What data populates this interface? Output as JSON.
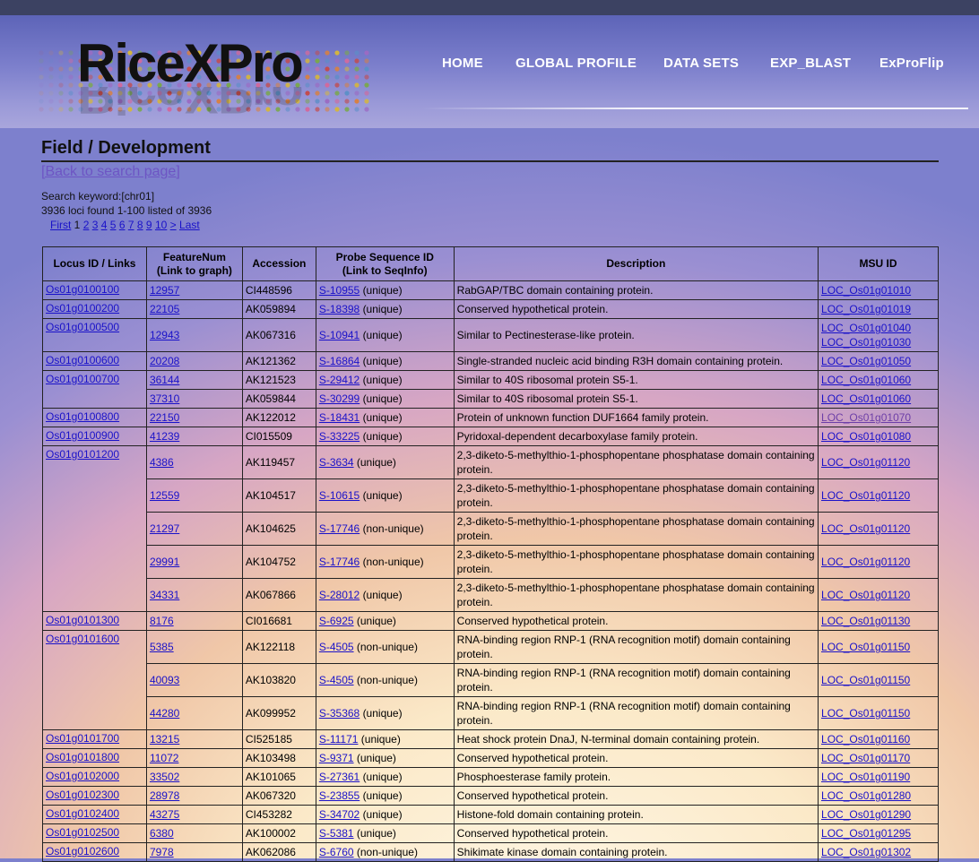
{
  "logo": {
    "text": "RiceXPro"
  },
  "nav": {
    "home": "HOME",
    "global": "GLOBAL PROFILE",
    "datasets": "DATA SETS",
    "expblast": "EXP_BLAST",
    "exproflip": "ExProFlip"
  },
  "page": {
    "title": "Field / Development",
    "back": "[Back to search page]",
    "keyword": "Search keyword:[chr01]",
    "found": "3936 loci found 1-100 listed of 3936",
    "pager": {
      "first": "First",
      "current": "1",
      "pages": [
        "2",
        "3",
        "4",
        "5",
        "6",
        "7",
        "8",
        "9",
        "10"
      ],
      "next": ">",
      "last": "Last"
    }
  },
  "table": {
    "headers": {
      "locus": "Locus ID / Links",
      "feature1": "FeatureNum",
      "feature2": "(Link to graph)",
      "accession": "Accession",
      "probe1": "Probe Sequence ID",
      "probe2": "(Link to SeqInfo)",
      "description": "Description",
      "msu": "MSU ID"
    },
    "groups": [
      {
        "locus": "Os01g0100100",
        "rows": [
          {
            "feature": "12957",
            "accession": "CI448596",
            "probe": "S-10955",
            "uniq": "(unique)",
            "desc": "RabGAP/TBC domain containing protein.",
            "msu": [
              "LOC_Os01g01010"
            ]
          }
        ]
      },
      {
        "locus": "Os01g0100200",
        "rows": [
          {
            "feature": "22105",
            "accession": "AK059894",
            "probe": "S-18398",
            "uniq": "(unique)",
            "desc": "Conserved hypothetical protein.",
            "msu": [
              "LOC_Os01g01019"
            ]
          }
        ]
      },
      {
        "locus": "Os01g0100500",
        "rows": [
          {
            "feature": "12943",
            "accession": "AK067316",
            "probe": "S-10941",
            "uniq": "(unique)",
            "desc": "Similar to Pectinesterase-like protein.",
            "msu": [
              "LOC_Os01g01040",
              "LOC_Os01g01030"
            ]
          }
        ]
      },
      {
        "locus": "Os01g0100600",
        "rows": [
          {
            "feature": "20208",
            "accession": "AK121362",
            "probe": "S-16864",
            "uniq": "(unique)",
            "desc": "Single-stranded nucleic acid binding R3H domain containing protein.",
            "msu": [
              "LOC_Os01g01050"
            ]
          }
        ]
      },
      {
        "locus": "Os01g0100700",
        "rows": [
          {
            "feature": "36144",
            "accession": "AK121523",
            "probe": "S-29412",
            "uniq": "(unique)",
            "desc": "Similar to 40S ribosomal protein S5-1.",
            "msu": [
              "LOC_Os01g01060"
            ]
          },
          {
            "feature": "37310",
            "accession": "AK059844",
            "probe": "S-30299",
            "uniq": "(unique)",
            "desc": "Similar to 40S ribosomal protein S5-1.",
            "msu": [
              "LOC_Os01g01060"
            ]
          }
        ]
      },
      {
        "locus": "Os01g0100800",
        "rows": [
          {
            "feature": "22150",
            "accession": "AK122012",
            "probe": "S-18431",
            "uniq": "(unique)",
            "desc": "Protein of unknown function DUF1664 family protein.",
            "msu": [
              "LOC_Os01g01070"
            ]
          }
        ]
      },
      {
        "locus": "Os01g0100900",
        "rows": [
          {
            "feature": "41239",
            "accession": "CI015509",
            "probe": "S-33225",
            "uniq": "(unique)",
            "desc": "Pyridoxal-dependent decarboxylase family protein.",
            "msu": [
              "LOC_Os01g01080"
            ]
          }
        ]
      },
      {
        "locus": "Os01g0101200",
        "rows": [
          {
            "feature": "4386",
            "accession": "AK119457",
            "probe": "S-3634",
            "uniq": "(unique)",
            "desc": "2,3-diketo-5-methylthio-1-phosphopentane phosphatase domain containing protein.",
            "msu": [
              "LOC_Os01g01120"
            ]
          },
          {
            "feature": "12559",
            "accession": "AK104517",
            "probe": "S-10615",
            "uniq": "(unique)",
            "desc": "2,3-diketo-5-methylthio-1-phosphopentane phosphatase domain containing protein.",
            "msu": [
              "LOC_Os01g01120"
            ]
          },
          {
            "feature": "21297",
            "accession": "AK104625",
            "probe": "S-17746",
            "uniq": "(non-unique)",
            "desc": "2,3-diketo-5-methylthio-1-phosphopentane phosphatase domain containing protein.",
            "msu": [
              "LOC_Os01g01120"
            ]
          },
          {
            "feature": "29991",
            "accession": "AK104752",
            "probe": "S-17746",
            "uniq": "(non-unique)",
            "desc": "2,3-diketo-5-methylthio-1-phosphopentane phosphatase domain containing protein.",
            "msu": [
              "LOC_Os01g01120"
            ]
          },
          {
            "feature": "34331",
            "accession": "AK067866",
            "probe": "S-28012",
            "uniq": "(unique)",
            "desc": "2,3-diketo-5-methylthio-1-phosphopentane phosphatase domain containing protein.",
            "msu": [
              "LOC_Os01g01120"
            ]
          }
        ]
      },
      {
        "locus": "Os01g0101300",
        "rows": [
          {
            "feature": "8176",
            "accession": "CI016681",
            "probe": "S-6925",
            "uniq": "(unique)",
            "desc": "Conserved hypothetical protein.",
            "msu": [
              "LOC_Os01g01130"
            ]
          }
        ]
      },
      {
        "locus": "Os01g0101600",
        "rows": [
          {
            "feature": "5385",
            "accession": "AK122118",
            "probe": "S-4505",
            "uniq": "(non-unique)",
            "desc": "RNA-binding region RNP-1 (RNA recognition motif) domain containing protein.",
            "msu": [
              "LOC_Os01g01150"
            ]
          },
          {
            "feature": "40093",
            "accession": "AK103820",
            "probe": "S-4505",
            "uniq": "(non-unique)",
            "desc": "RNA-binding region RNP-1 (RNA recognition motif) domain containing protein.",
            "msu": [
              "LOC_Os01g01150"
            ]
          },
          {
            "feature": "44280",
            "accession": "AK099952",
            "probe": "S-35368",
            "uniq": "(unique)",
            "desc": "RNA-binding region RNP-1 (RNA recognition motif) domain containing protein.",
            "msu": [
              "LOC_Os01g01150"
            ]
          }
        ]
      },
      {
        "locus": "Os01g0101700",
        "rows": [
          {
            "feature": "13215",
            "accession": "CI525185",
            "probe": "S-11171",
            "uniq": "(unique)",
            "desc": "Heat shock protein DnaJ, N-terminal domain containing protein.",
            "msu": [
              "LOC_Os01g01160"
            ]
          }
        ]
      },
      {
        "locus": "Os01g0101800",
        "rows": [
          {
            "feature": "11072",
            "accession": "AK103498",
            "probe": "S-9371",
            "uniq": "(unique)",
            "desc": "Conserved hypothetical protein.",
            "msu": [
              "LOC_Os01g01170"
            ]
          }
        ]
      },
      {
        "locus": "Os01g0102000",
        "rows": [
          {
            "feature": "33502",
            "accession": "AK101065",
            "probe": "S-27361",
            "uniq": "(unique)",
            "desc": "Phosphoesterase family protein.",
            "msu": [
              "LOC_Os01g01190"
            ]
          }
        ]
      },
      {
        "locus": "Os01g0102300",
        "rows": [
          {
            "feature": "28978",
            "accession": "AK067320",
            "probe": "S-23855",
            "uniq": "(unique)",
            "desc": "Conserved hypothetical protein.",
            "msu": [
              "LOC_Os01g01280"
            ]
          }
        ]
      },
      {
        "locus": "Os01g0102400",
        "rows": [
          {
            "feature": "43275",
            "accession": "CI453282",
            "probe": "S-34702",
            "uniq": "(unique)",
            "desc": "Histone-fold domain containing protein.",
            "msu": [
              "LOC_Os01g01290"
            ]
          }
        ]
      },
      {
        "locus": "Os01g0102500",
        "rows": [
          {
            "feature": "6380",
            "accession": "AK100002",
            "probe": "S-5381",
            "uniq": "(unique)",
            "desc": "Conserved hypothetical protein.",
            "msu": [
              "LOC_Os01g01295"
            ]
          }
        ]
      },
      {
        "locus": "Os01g0102600",
        "rows": [
          {
            "feature": "7978",
            "accession": "AK062086",
            "probe": "S-6760",
            "uniq": "(non-unique)",
            "desc": "Shikimate kinase domain containing protein.",
            "msu": [
              "LOC_Os01g01302"
            ]
          }
        ]
      }
    ]
  }
}
